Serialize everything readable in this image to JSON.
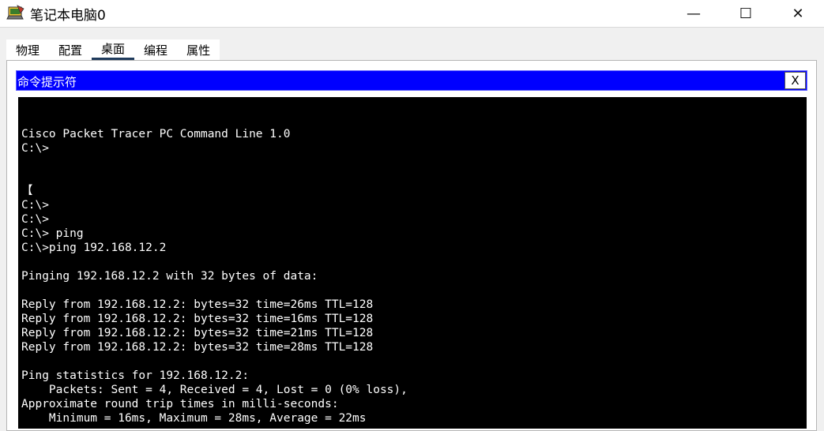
{
  "window": {
    "title": "笔记本电脑0",
    "controls": {
      "minimize": "—",
      "maximize": "☐",
      "close": "✕"
    }
  },
  "tabs": [
    {
      "label": "物理",
      "active": false
    },
    {
      "label": "配置",
      "active": false
    },
    {
      "label": "桌面",
      "active": true
    },
    {
      "label": "编程",
      "active": false
    },
    {
      "label": "属性",
      "active": false
    }
  ],
  "command_prompt": {
    "title": "命令提示符",
    "close_label": "X",
    "lines": [
      "",
      "Cisco Packet Tracer PC Command Line 1.0",
      "C:\\>",
      "",
      "",
      "【",
      "C:\\>",
      "C:\\>",
      "C:\\> ping",
      "C:\\>ping 192.168.12.2",
      "",
      "Pinging 192.168.12.2 with 32 bytes of data:",
      "",
      "Reply from 192.168.12.2: bytes=32 time=26ms TTL=128",
      "Reply from 192.168.12.2: bytes=32 time=16ms TTL=128",
      "Reply from 192.168.12.2: bytes=32 time=21ms TTL=128",
      "Reply from 192.168.12.2: bytes=32 time=28ms TTL=128",
      "",
      "Ping statistics for 192.168.12.2:",
      "    Packets: Sent = 4, Received = 4, Lost = 0 (0% loss),",
      "Approximate round trip times in milli-seconds:",
      "    Minimum = 16ms, Maximum = 28ms, Average = 22ms"
    ]
  },
  "colors": {
    "header_blue": "#0000ff",
    "terminal_bg": "#000000",
    "terminal_fg": "#ffffff",
    "active_tab_underline": "#1f3b5c"
  },
  "icons": {
    "app": "packet-tracer-laptop-icon"
  }
}
